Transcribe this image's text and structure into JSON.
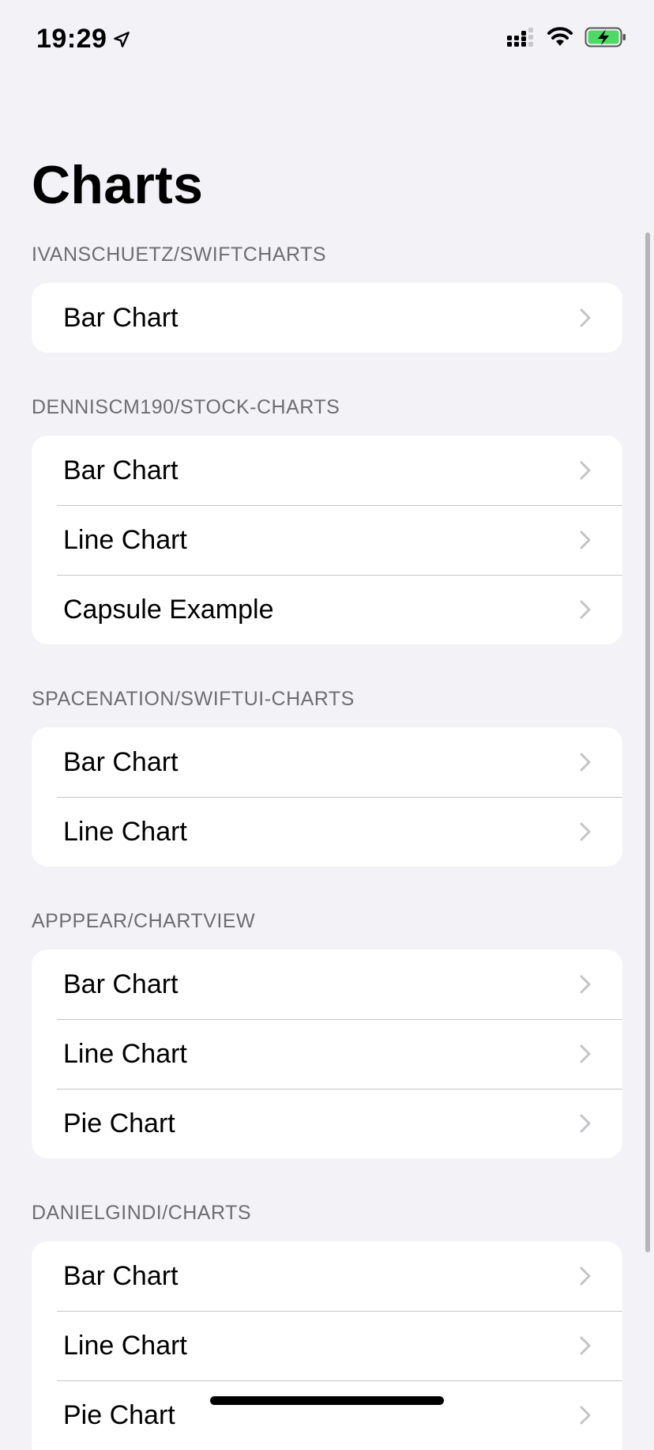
{
  "status": {
    "time": "19:29",
    "location_icon": "location-arrow-icon",
    "signal_icon": "cellular-signal-icon",
    "wifi_icon": "wifi-icon",
    "battery_icon": "battery-charging-icon",
    "battery_color": "#4cd964"
  },
  "page": {
    "title": "Charts"
  },
  "sections": [
    {
      "header": "IVANSCHUETZ/SWIFTCHARTS",
      "items": [
        "Bar Chart"
      ]
    },
    {
      "header": "DENNISCM190/STOCK-CHARTS",
      "items": [
        "Bar Chart",
        "Line Chart",
        "Capsule Example"
      ]
    },
    {
      "header": "SPACENATION/SWIFTUI-CHARTS",
      "items": [
        "Bar Chart",
        "Line Chart"
      ]
    },
    {
      "header": "APPPEAR/CHARTVIEW",
      "items": [
        "Bar Chart",
        "Line Chart",
        "Pie Chart"
      ]
    },
    {
      "header": "DANIELGINDI/CHARTS",
      "items": [
        "Bar Chart",
        "Line Chart",
        "Pie Chart"
      ]
    }
  ],
  "colors": {
    "background": "#f2f2f7",
    "header_text": "#6d6d72",
    "chevron": "#c4c4c7",
    "separator": "#c6c6c8"
  }
}
